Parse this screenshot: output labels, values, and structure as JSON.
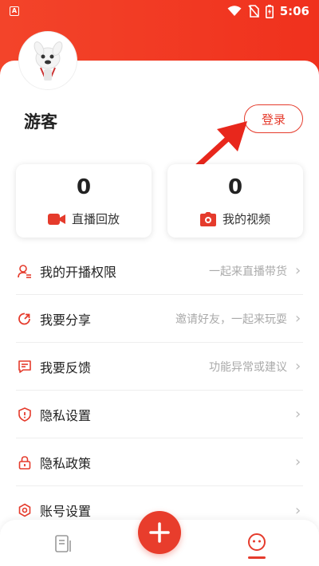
{
  "status_bar": {
    "time": "5:06",
    "app_icon_letter": "A"
  },
  "profile": {
    "username": "游客",
    "login_label": "登录"
  },
  "stats": [
    {
      "value": "0",
      "label": "直播回放",
      "icon": "video-camera-icon"
    },
    {
      "value": "0",
      "label": "我的视频",
      "icon": "camera-icon"
    }
  ],
  "menu": [
    {
      "label": "我的开播权限",
      "hint": "一起来直播带货",
      "icon": "user-permission-icon"
    },
    {
      "label": "我要分享",
      "hint": "邀请好友，一起来玩耍",
      "icon": "share-icon"
    },
    {
      "label": "我要反馈",
      "hint": "功能异常或建议",
      "icon": "feedback-icon"
    },
    {
      "label": "隐私设置",
      "hint": "",
      "icon": "shield-icon"
    },
    {
      "label": "隐私政策",
      "hint": "",
      "icon": "lock-icon"
    },
    {
      "label": "账号设置",
      "hint": "",
      "icon": "account-settings-icon"
    }
  ],
  "colors": {
    "brand_red": "#e53b2c",
    "header_red": "#f3442a"
  }
}
